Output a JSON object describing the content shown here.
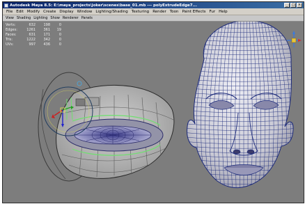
{
  "window": {
    "title": "Autodesk Maya 8.5: E:\\maya_projects\\joker\\scenes\\base_01.mb  ---  polyExtrudeEdge7..."
  },
  "menubar": {
    "items": [
      "File",
      "Edit",
      "Modify",
      "Create",
      "Display",
      "Window",
      "Lighting/Shading",
      "Texturing",
      "Render",
      "Toon",
      "Paint Effects",
      "Fur",
      "Help"
    ]
  },
  "panel_menu": {
    "items": [
      "View",
      "Shading",
      "Lighting",
      "Show",
      "Renderer",
      "Panels"
    ]
  },
  "hud": {
    "rows": [
      {
        "label": "Verts:",
        "a": "632",
        "b": "198",
        "c": "0"
      },
      {
        "label": "Edges:",
        "a": "1261",
        "b": "361",
        "c": "19"
      },
      {
        "label": "Faces:",
        "a": "631",
        "b": "171",
        "c": "0"
      },
      {
        "label": "Tris:",
        "a": "1222",
        "b": "342",
        "c": "0"
      },
      {
        "label": "UVs:",
        "a": "997",
        "b": "436",
        "c": "0"
      }
    ]
  },
  "colors": {
    "viewport_bg": "#7d7d7d",
    "wire": "#1c2a7a",
    "titlebar": "#0a246a",
    "selection_green": "#6ee06e",
    "shell_gray": "#b9b9b9"
  },
  "icons": [
    "maya-app-icon",
    "view-cube-axes-icon",
    "move-manipulator-icon",
    "rotate-manipulator-icon"
  ]
}
